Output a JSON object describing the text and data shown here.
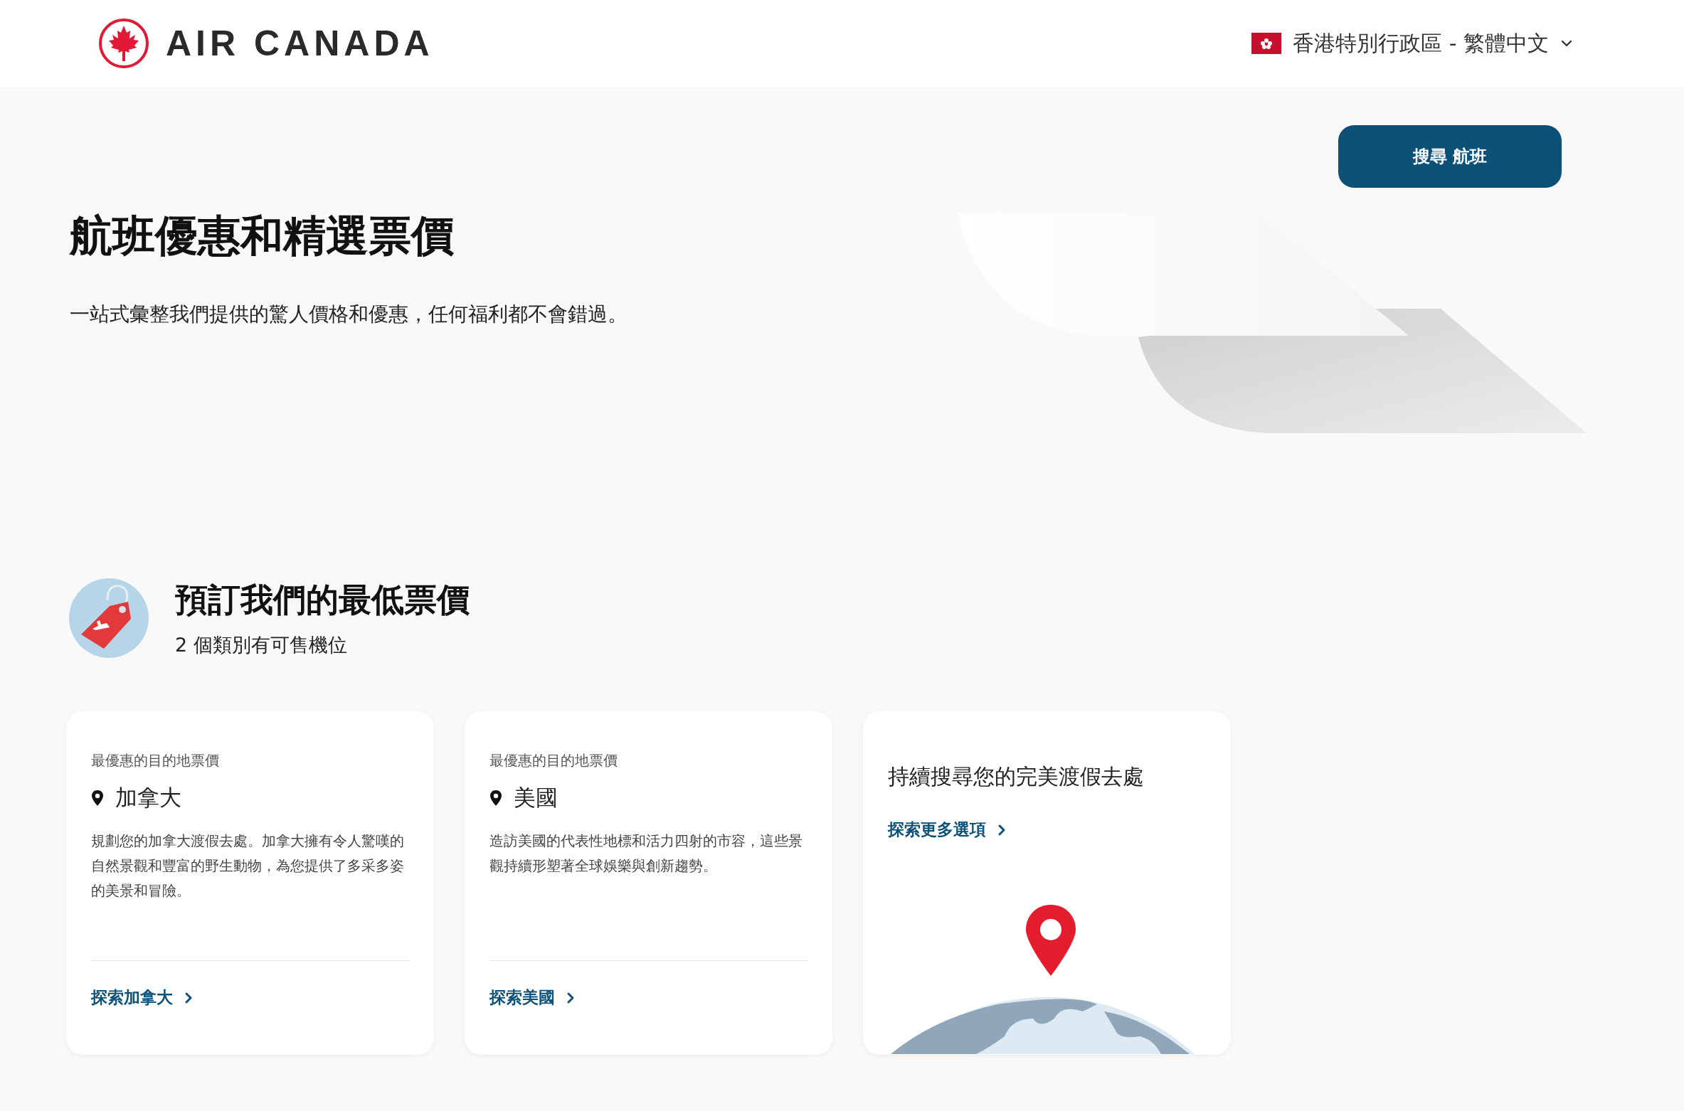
{
  "header": {
    "logo_text": "AIR CANADA",
    "locale": "香港特別行政區 - 繁體中文"
  },
  "hero": {
    "search_button": "搜尋 航班",
    "title": "航班優惠和精選票價",
    "subtitle": "一站式彙整我們提供的驚人價格和優惠，任何福利都不會錯過。"
  },
  "section": {
    "title": "預訂我們的最低票價",
    "subtitle": "2 個類別有可售機位"
  },
  "cards": [
    {
      "kind": "destination",
      "label": "最優惠的目的地票價",
      "destination": "加拿大",
      "description": "規劃您的加拿大渡假去處。加拿大擁有令人驚嘆的自然景觀和豐富的野生動物，為您提供了多采多姿的美景和冒險。",
      "link": "探索加拿大"
    },
    {
      "kind": "destination",
      "label": "最優惠的目的地票價",
      "destination": "美國",
      "description": "造訪美國的代表性地標和活力四射的市容，這些景觀持續形塑著全球娛樂與創新趨勢。",
      "link": "探索美國"
    },
    {
      "kind": "promo",
      "title": "持續搜尋您的完美渡假去處",
      "link": "探索更多選項"
    }
  ]
}
